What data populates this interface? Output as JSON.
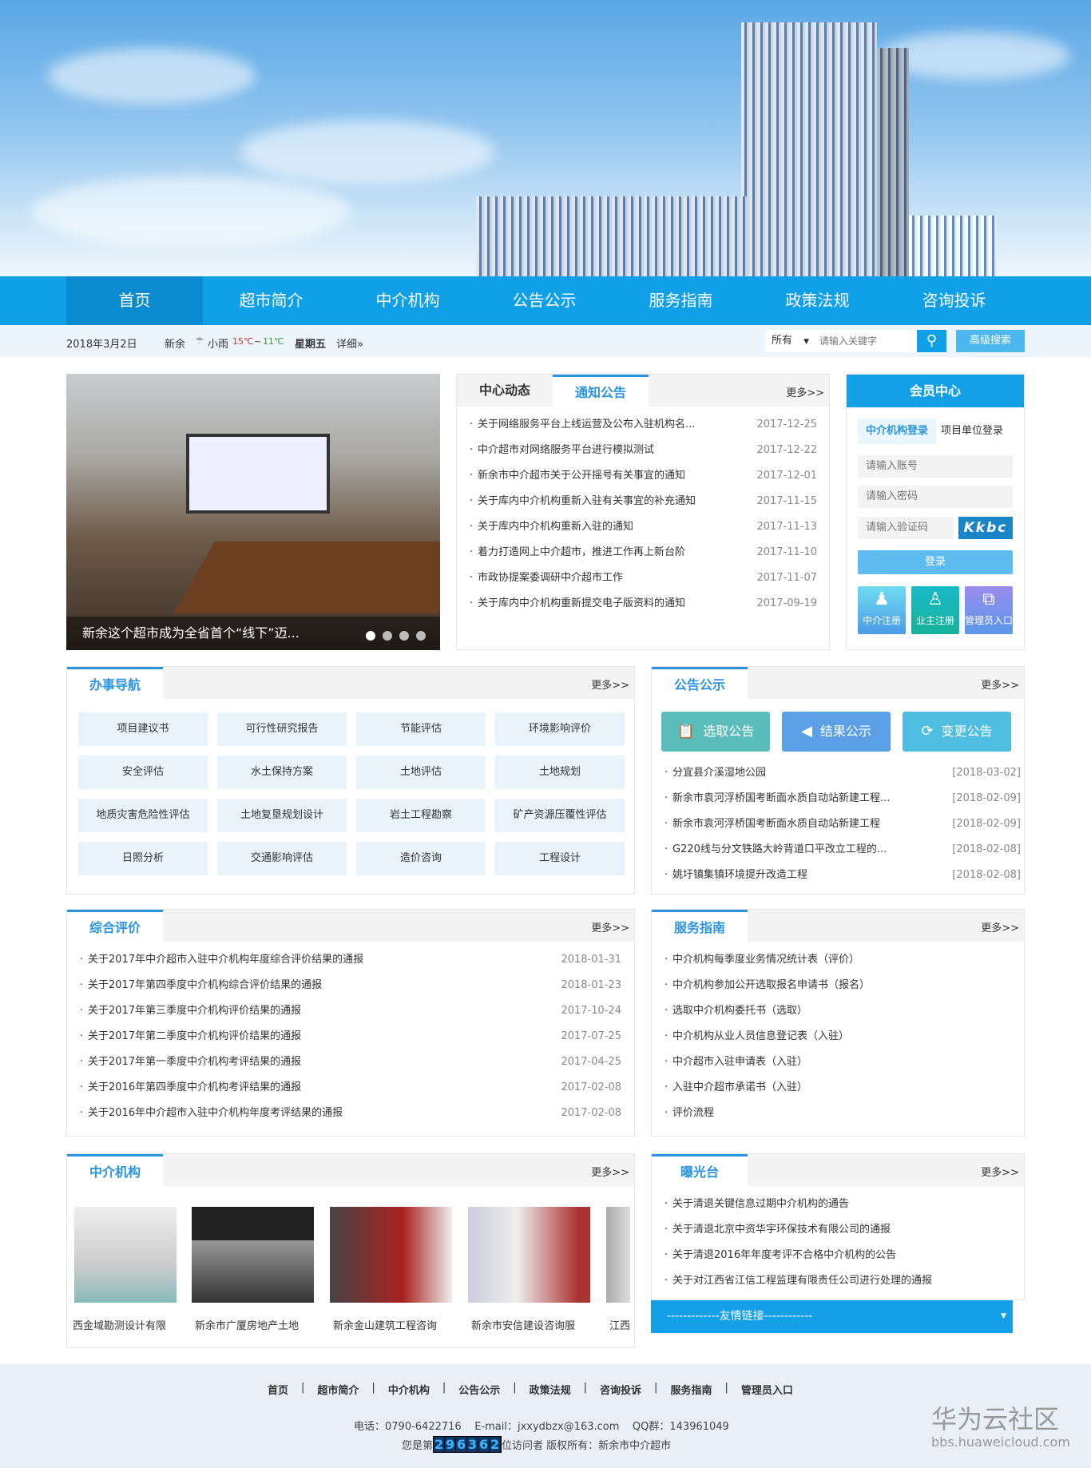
{
  "nav": [
    "首页",
    "超市简介",
    "中介机构",
    "公告公示",
    "服务指南",
    "政策法规",
    "咨询投诉"
  ],
  "info": {
    "date": "2018年3月2日",
    "city": "新余",
    "weather": "小雨",
    "temp_high": "15℃",
    "tilde": "~",
    "temp_low": "11℃",
    "weekday": "星期五",
    "detail": "详细»"
  },
  "search": {
    "scope": "所有",
    "placeholder": "请输入关键字",
    "advanced": "高级搜索"
  },
  "slider": {
    "caption": "新余这个超市成为全省首个“线下”迈...",
    "slides": 4,
    "active": 1
  },
  "news": {
    "tabs": [
      "中心动态",
      "通知公告"
    ],
    "active_tab": 1,
    "more": "更多>>",
    "items": [
      {
        "t": "关于网络服务平台上线运营及公布入驻机构名...",
        "d": "2017-12-25"
      },
      {
        "t": "中介超市对网络服务平台进行模拟测试",
        "d": "2017-12-22"
      },
      {
        "t": "新余市中介超市关于公开摇号有关事宜的通知",
        "d": "2017-12-01"
      },
      {
        "t": "关于库内中介机构重新入驻有关事宜的补充通知",
        "d": "2017-11-15"
      },
      {
        "t": "关于库内中介机构重新入驻的通知",
        "d": "2017-11-13"
      },
      {
        "t": "着力打造网上中介超市，推进工作再上新台阶",
        "d": "2017-11-10"
      },
      {
        "t": "市政协提案委调研中介超市工作",
        "d": "2017-11-07"
      },
      {
        "t": "关于库内中介机构重新提交电子版资料的通知",
        "d": "2017-09-19"
      }
    ]
  },
  "member": {
    "title": "会员中心",
    "tabs": [
      "中介机构登录",
      "项目单位登录"
    ],
    "account": "请输入账号",
    "password": "请输入密码",
    "captcha_ph": "请输入验证码",
    "captcha": "Kkbc",
    "login": "登录",
    "links": [
      "中介注册",
      "业主注册",
      "管理员入口"
    ]
  },
  "guide": {
    "title": "办事导航",
    "more": "更多>>",
    "items": [
      "项目建议书",
      "可行性研究报告",
      "节能评估",
      "环境影响评价",
      "安全评估",
      "水土保持方案",
      "土地评估",
      "土地规划",
      "地质灾害危险性评估",
      "土地复垦规划设计",
      "岩土工程勘察",
      "矿产资源压覆性评估",
      "日照分析",
      "交通影响评估",
      "造价咨询",
      "工程设计"
    ]
  },
  "notice": {
    "title": "公告公示",
    "more": "更多>>",
    "buttons": [
      "选取公告",
      "结果公示",
      "变更公告"
    ],
    "items": [
      {
        "t": "分宜县介溪湿地公园",
        "d": "[2018-03-02]"
      },
      {
        "t": "新余市袁河浮桥国考断面水质自动站新建工程...",
        "d": "[2018-02-09]"
      },
      {
        "t": "新余市袁河浮桥国考断面水质自动站新建工程",
        "d": "[2018-02-09]"
      },
      {
        "t": "G220线与分文铁路大岭背道口平改立工程的...",
        "d": "[2018-02-08]"
      },
      {
        "t": "姚圩镇集镇环境提升改造工程",
        "d": "[2018-02-08]"
      }
    ]
  },
  "evaluation": {
    "title": "综合评价",
    "more": "更多>>",
    "items": [
      {
        "t": "关于2017年中介超市入驻中介机构年度综合评价结果的通报",
        "d": "2018-01-31"
      },
      {
        "t": "关于2017年第四季度中介机构综合评价结果的通报",
        "d": "2018-01-23"
      },
      {
        "t": "关于2017年第三季度中介机构评价结果的通报",
        "d": "2017-10-24"
      },
      {
        "t": "关于2017年第二季度中介机构评价结果的通报",
        "d": "2017-07-25"
      },
      {
        "t": "关于2017年第一季度中介机构考评结果的通报",
        "d": "2017-04-25"
      },
      {
        "t": "关于2016年第四季度中介机构考评结果的通报",
        "d": "2017-02-08"
      },
      {
        "t": "关于2016年中介超市入驻中介机构年度考评结果的通报",
        "d": "2017-02-08"
      }
    ]
  },
  "service": {
    "title": "服务指南",
    "more": "更多>>",
    "items": [
      "中介机构每季度业务情况统计表（评价）",
      "中介机构参加公开选取报名申请书（报名）",
      "选取中介机构委托书（选取）",
      "中介机构从业人员信息登记表（入驻）",
      "中介超市入驻申请表（入驻）",
      "入驻中介超市承诺书（入驻）",
      "评价流程"
    ]
  },
  "agencies": {
    "title": "中介机构",
    "more": "更多>>",
    "items": [
      "西金域勘测设计有限",
      "新余市广厦房地产土地",
      "新余金山建筑工程咨询",
      "新余市安信建设咨询服",
      "江西"
    ]
  },
  "exposure": {
    "title": "曝光台",
    "more": "更多>>",
    "items": [
      "关于清退关键信息过期中介机构的通告",
      "关于清退北京中资华宇环保技术有限公司的通报",
      "关于清退2016年年度考评不合格中介机构的公告",
      "关于对江西省江信工程监理有限责任公司进行处理的通报"
    ]
  },
  "friend_links": "-------------友情链接------------",
  "footer": {
    "links": [
      "首页",
      "超市简介",
      "中介机构",
      "公告公示",
      "政策法规",
      "咨询投诉",
      "服务指南",
      "管理员入口"
    ],
    "contact": "电话：0790-6422716    E-mail：jxxydbzx@163.com    QQ群：143961049",
    "visitor_prefix": "您是第",
    "visitor_count": "296362",
    "visitor_suffix": "位访问者 版权所有：新余市中介超市"
  },
  "watermark": {
    "title": "华为云社区",
    "url": "bbs.huaweicloud.com"
  }
}
